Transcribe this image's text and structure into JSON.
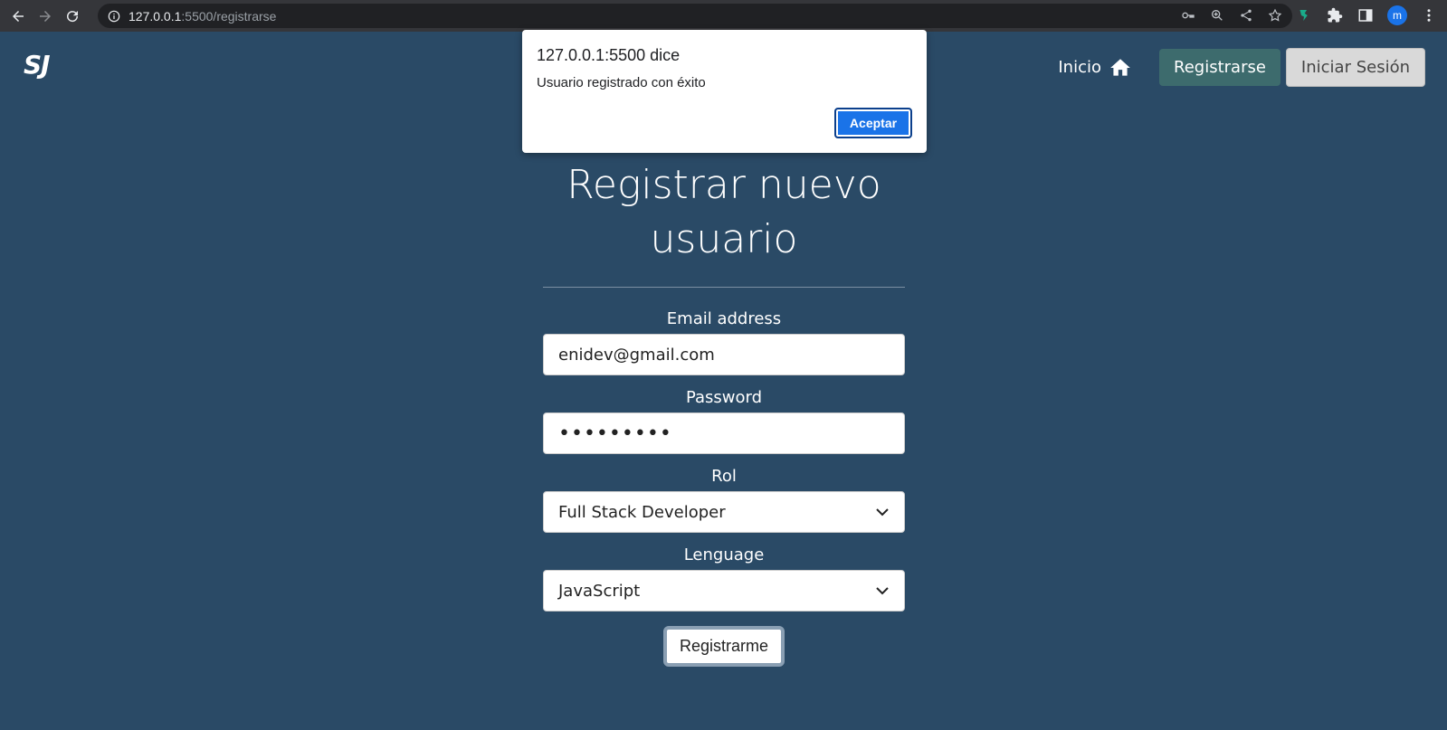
{
  "browser": {
    "url_host": "127.0.0.1",
    "url_path": ":5500/registrarse",
    "profile_initial": "m"
  },
  "page": {
    "logo": "SJ",
    "nav": {
      "home_label": "Inicio",
      "register_label": "Registrarse",
      "login_label": "Iniciar Sesión"
    },
    "form": {
      "title": "Registrar nuevo usuario",
      "email_label": "Email address",
      "email_value": "enidev@gmail.com",
      "password_label": "Password",
      "password_value": "•••••••••",
      "role_label": "Rol",
      "role_value": "Full Stack Developer",
      "language_label": "Lenguage",
      "language_value": "JavaScript",
      "submit_label": "Registrarme"
    }
  },
  "alert": {
    "origin": "127.0.0.1:5500 dice",
    "message": "Usuario registrado con éxito",
    "ok_label": "Aceptar"
  },
  "colors": {
    "page_bg": "#2a4a66",
    "register_btn": "#3d6b6d",
    "alert_button": "#1a73e8"
  }
}
